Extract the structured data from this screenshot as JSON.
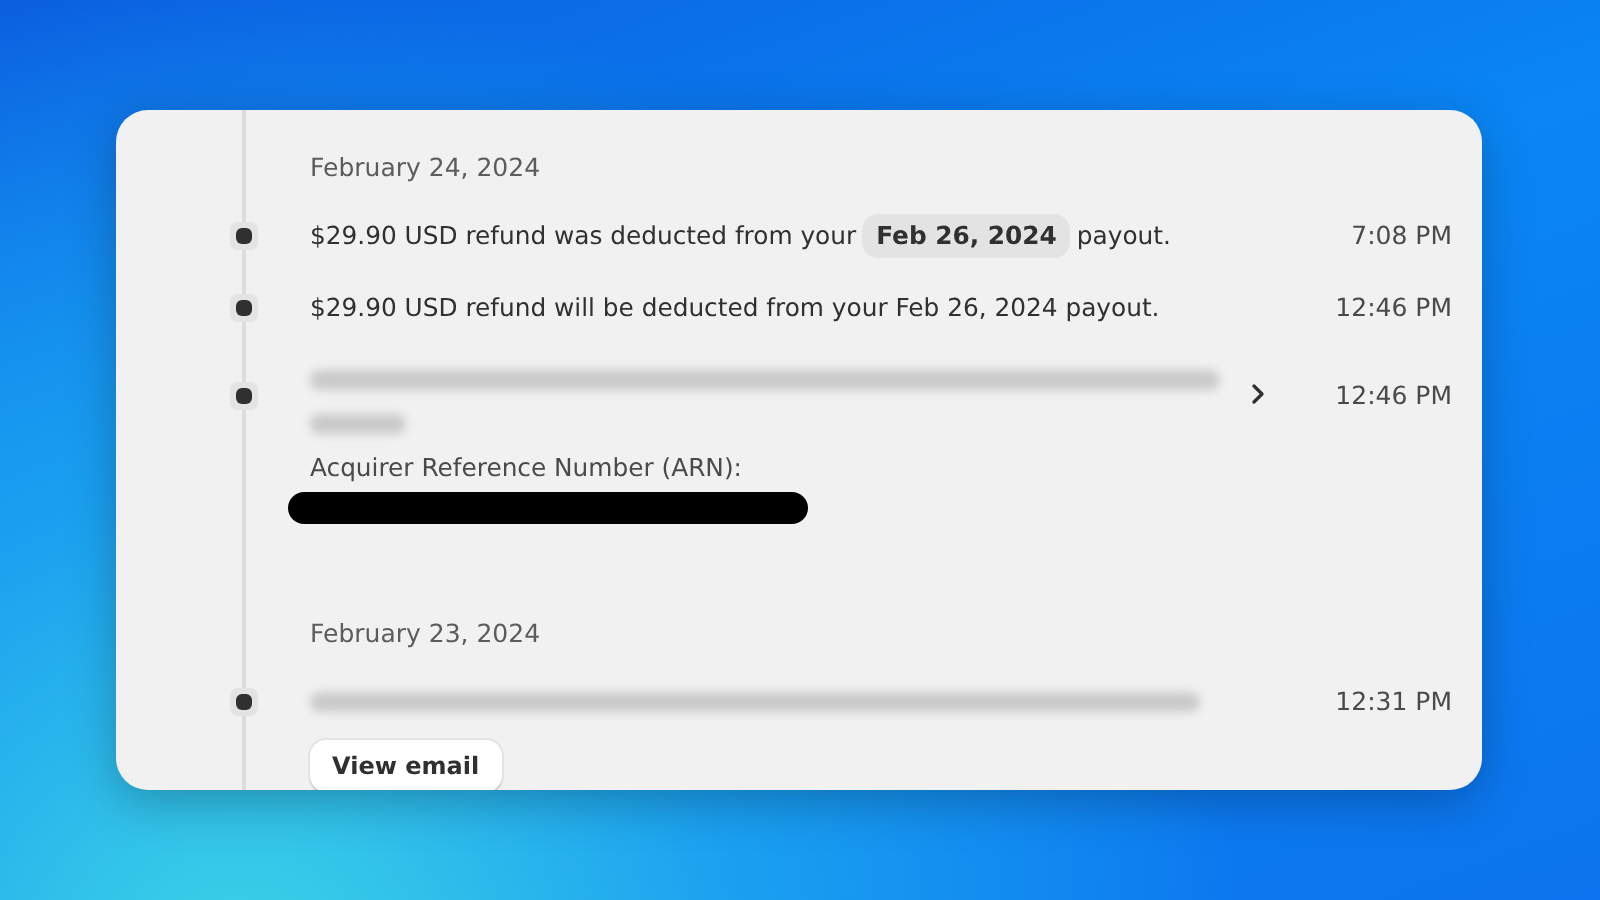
{
  "groups": [
    {
      "date": "February 24, 2024",
      "events": [
        {
          "kind": "text",
          "text_before": "$29.90 USD refund was deducted from your",
          "badge": "Feb 26, 2024",
          "text_after": "payout.",
          "time": "7:08 PM"
        },
        {
          "kind": "text",
          "text_before": "$29.90 USD refund will be deducted from your Feb 26, 2024 payout.",
          "time": "12:46 PM"
        },
        {
          "kind": "blurred-two-line",
          "chevron": true,
          "arn_label": "Acquirer Reference Number (ARN):",
          "arn_redacted": true,
          "time": "12:46 PM"
        }
      ]
    },
    {
      "date": "February 23, 2024",
      "events": [
        {
          "kind": "blurred-one-line",
          "button": "View email",
          "time": "12:31 PM"
        }
      ]
    }
  ]
}
